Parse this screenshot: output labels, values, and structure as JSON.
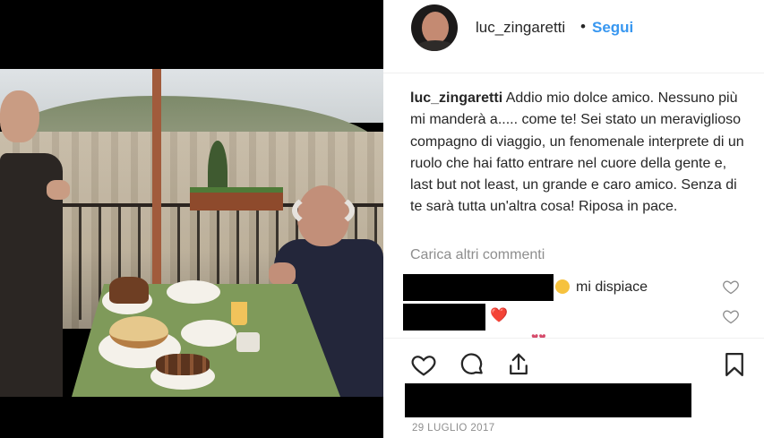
{
  "post": {
    "username": "luc_zingaretti",
    "separator": "•",
    "follow_label": "Segui",
    "caption_username": "luc_zingaretti",
    "caption_text": "Addio mio dolce amico. Nessuno più mi manderà a..... come te! Sei stato un meraviglioso compagno di viaggio, un fenomenale interprete di un ruolo che hai fatto entrare nel cuore della gente e, last but not least, un grande e caro amico. Senza di te sarà tutta un'altra cosa! Riposa in pace.",
    "load_more_comments": "Carica altri commenti",
    "comments": [
      {
        "text": "mi dispiace",
        "emoji": "crying-face"
      },
      {
        "text": "❤️",
        "emoji": "red-heart"
      },
      {
        "text": "...",
        "emoji": "hearts"
      }
    ],
    "date": "29 LUGLIO 2017"
  },
  "icons": {
    "like": "heart-outline-icon",
    "comment": "comment-bubble-icon",
    "share": "share-upload-icon",
    "save": "bookmark-icon"
  },
  "colors": {
    "follow": "#3897f0",
    "text": "#262626",
    "muted": "#8e8e8e"
  }
}
